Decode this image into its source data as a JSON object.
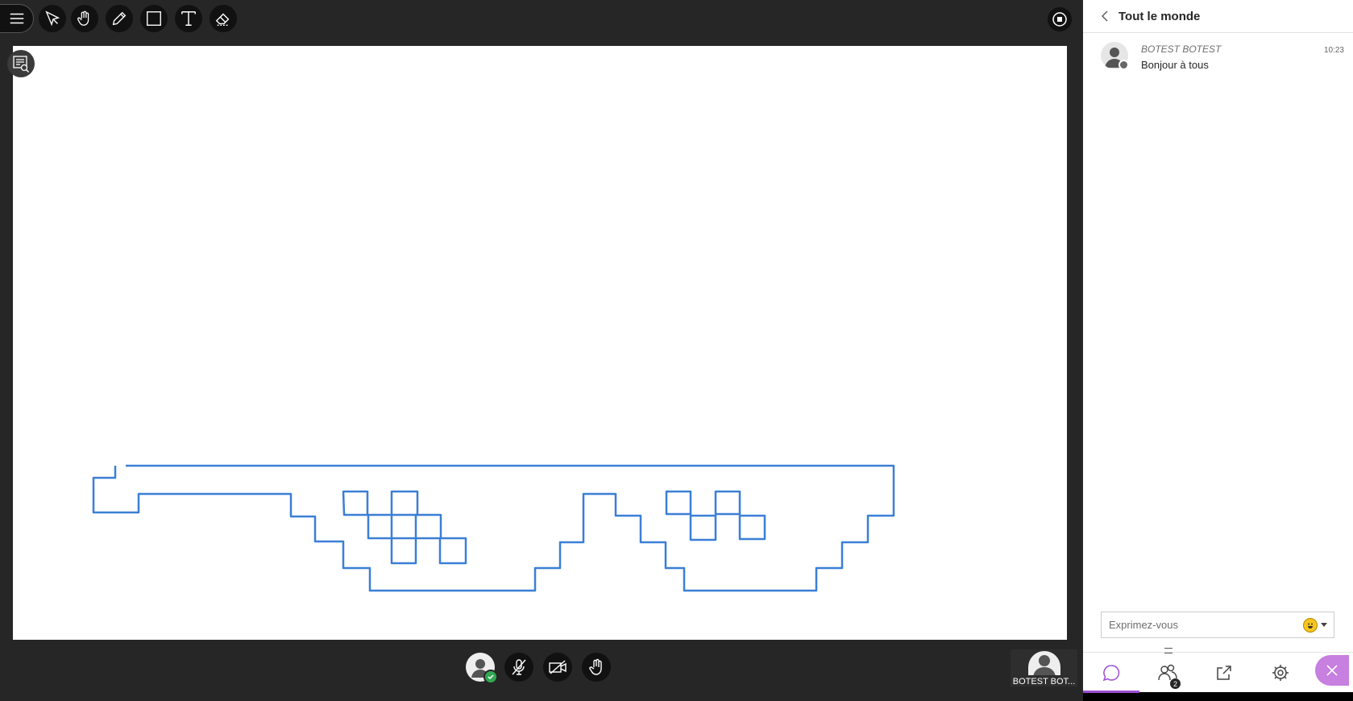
{
  "toolbar": {
    "tools": [
      "menu-icon",
      "select-pointer-icon",
      "pan-hand-icon",
      "pencil-icon",
      "rectangle-icon",
      "text-icon",
      "eraser-icon"
    ],
    "stop_icon": "stop-icon",
    "stroke_color": "#3a7fd6"
  },
  "whiteboard": {
    "drawing": "pixel sunglasses sketch"
  },
  "bottom_bar": {
    "controls": [
      "my-status-avatar",
      "microphone-off-icon",
      "camera-off-icon",
      "raise-hand-icon"
    ],
    "participant_name": "BOTEST BOT..."
  },
  "chat": {
    "title": "Tout le monde",
    "messages": [
      {
        "author": "BOTEST BOTEST",
        "time": "10:23",
        "text": "Bonjour à tous"
      }
    ],
    "compose_placeholder": "Exprimez-vous",
    "emoji_icon": "emoji-smiley-icon"
  },
  "panel_tabs": {
    "items": [
      "chat-icon",
      "attendees-icon",
      "share-content-icon",
      "settings-icon"
    ],
    "attendee_count": "2",
    "accent_color": "#9b4fd3"
  }
}
